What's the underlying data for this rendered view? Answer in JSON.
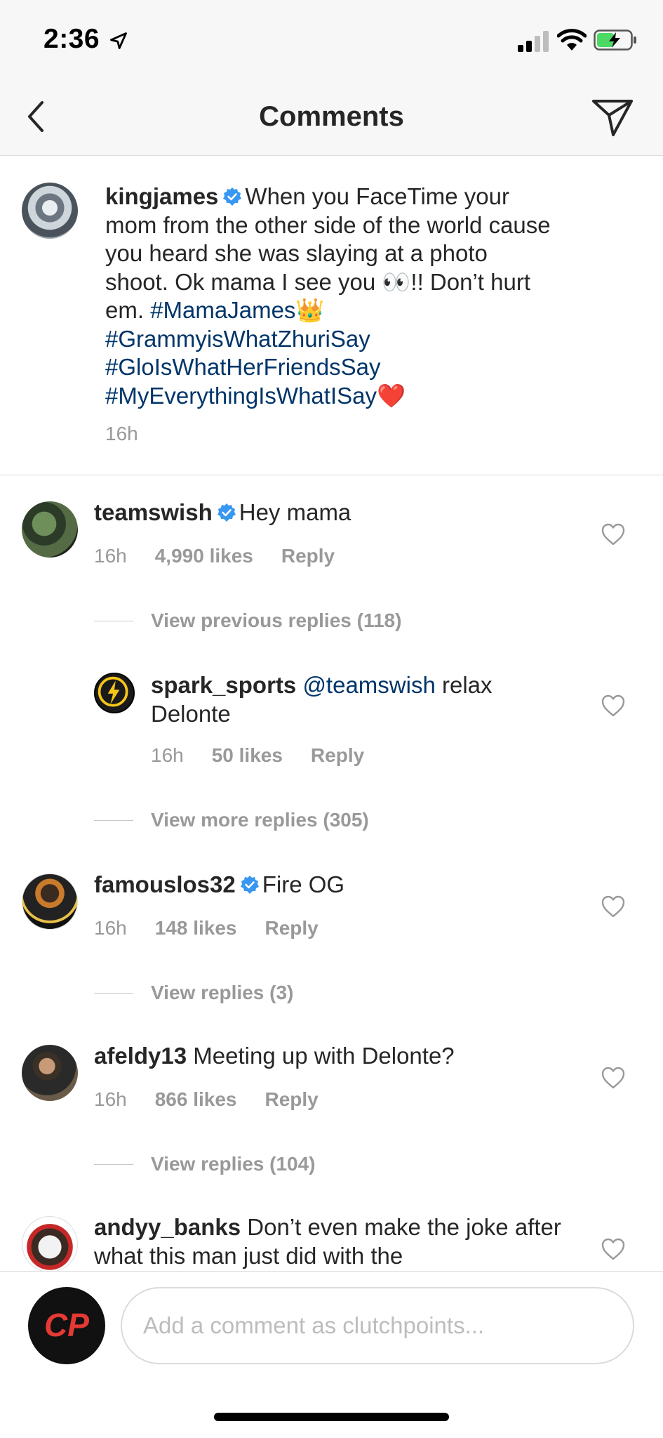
{
  "status_bar": {
    "time": "2:36"
  },
  "nav": {
    "title": "Comments"
  },
  "caption": {
    "username": "kingjames",
    "text_part1": "When you FaceTime your mom from the other side of the world cause you heard she was slaying at a photo shoot. Ok mama I see you 👀!! Don’t hurt em.",
    "hashtags": [
      "#MamaJames",
      "#GrammyisWhatZhuriSay",
      "#GloIsWhatHerFriendsSay",
      "#MyEverythingIsWhatISay"
    ],
    "emoji_crown": "👑",
    "emoji_heart": "❤️",
    "time": "16h"
  },
  "comments": [
    {
      "username": "teamswish",
      "text": "Hey mama",
      "time": "16h",
      "likes": "4,990 likes",
      "reply": "Reply",
      "view_more": "View previous replies (118)"
    },
    {
      "username": "spark_sports",
      "mention": "@teamswish",
      "text": "relax Delonte",
      "time": "16h",
      "likes": "50 likes",
      "reply": "Reply",
      "view_more": "View more replies (305)"
    },
    {
      "username": "famouslos32",
      "text": "Fire OG",
      "time": "16h",
      "likes": "148 likes",
      "reply": "Reply",
      "view_more": "View replies (3)"
    },
    {
      "username": "afeldy13",
      "text": "Meeting up with Delonte?",
      "time": "16h",
      "likes": "866 likes",
      "reply": "Reply",
      "view_more": "View replies (104)"
    },
    {
      "username": "andyy_banks",
      "text": "Don’t even make the joke after what this man just did with the"
    }
  ],
  "input": {
    "placeholder": "Add a comment as clutchpoints...",
    "avatar_text": "CP"
  },
  "colors": {
    "link": "#003569",
    "verified": "#3897f0",
    "meta": "#999999"
  }
}
